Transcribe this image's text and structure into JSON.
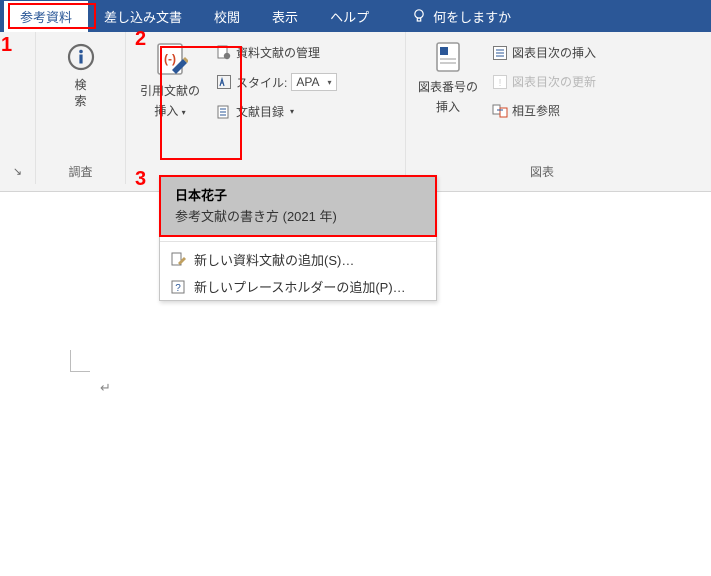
{
  "tabs": {
    "references": "参考資料",
    "mailings": "差し込み文書",
    "review": "校閲",
    "view": "表示",
    "help": "ヘルプ",
    "tellme": "何をしますか"
  },
  "annotations": {
    "a1": "1",
    "a2": "2",
    "a3": "3"
  },
  "groups": {
    "research": {
      "search": "検\n索",
      "label": "調査"
    },
    "citations": {
      "insertCitationLine1": "引用文献の",
      "insertCitationLine2": "挿入",
      "manageSources": "資料文献の管理",
      "styleLabel": "スタイル:",
      "styleValue": "APA",
      "bibliography": "文献目録"
    },
    "captions": {
      "insertCaptionLine1": "図表番号の",
      "insertCaptionLine2": "挿入",
      "insertTableFigures": "図表目次の挿入",
      "updateTable": "図表目次の更新",
      "crossRef": "相互参照",
      "label": "図表"
    }
  },
  "dropdown": {
    "citationAuthor": "日本花子",
    "citationWork": "参考文献の書き方 (2021 年)",
    "addNewSource": "新しい資料文献の追加(S)…",
    "addNewPlaceholder": "新しいプレースホルダーの追加(P)…"
  },
  "doc": {
    "returnMark": "↵"
  }
}
